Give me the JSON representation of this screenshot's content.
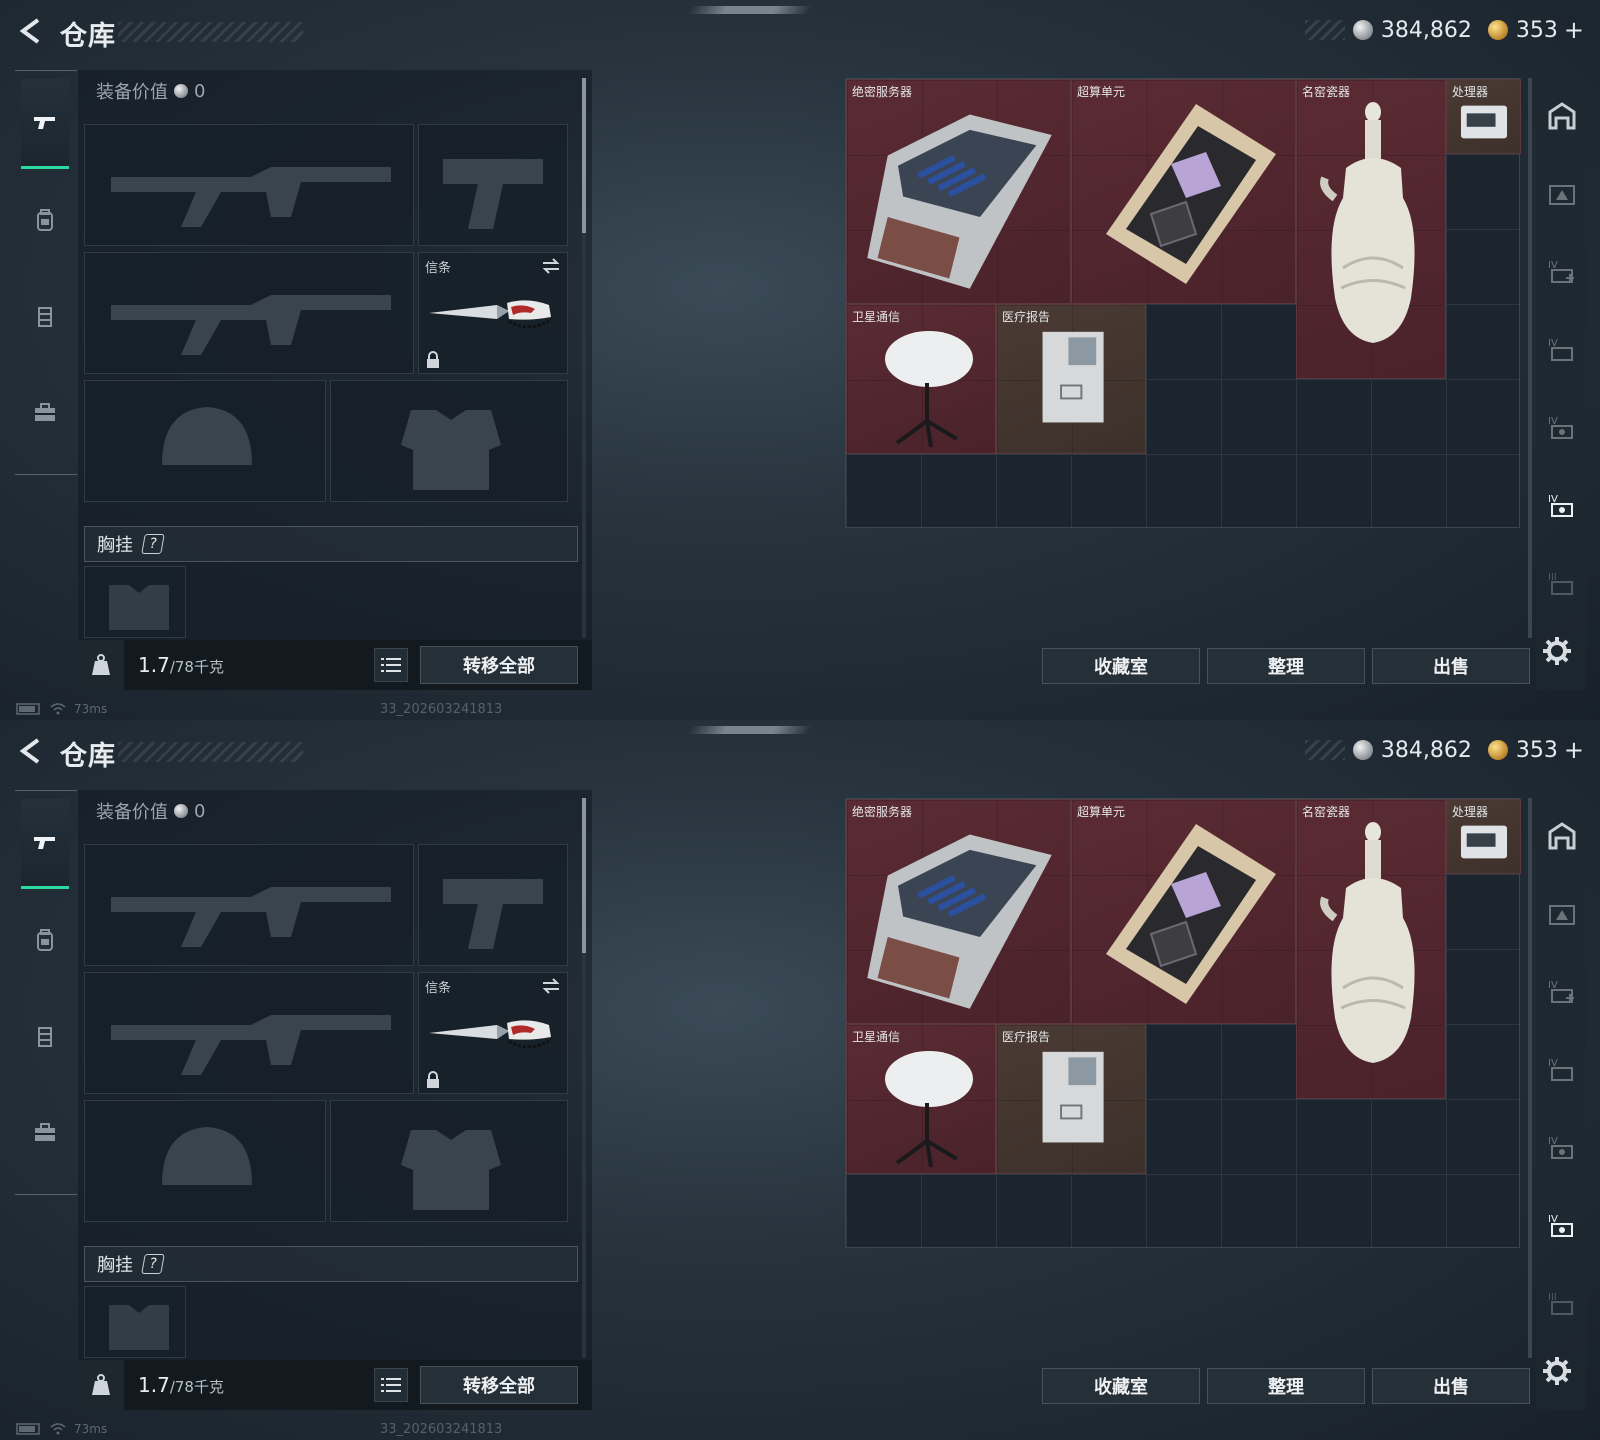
{
  "header": {
    "title": "仓库",
    "silver_amount": "384,862",
    "gold_amount": "353",
    "gold_plus": "+"
  },
  "left_rail": {
    "tabs": [
      "pistol-icon",
      "backpack-icon",
      "armor-vest-icon",
      "toolbox-icon"
    ],
    "active_index": 0
  },
  "equipment": {
    "value_label": "装备价值",
    "value": "0",
    "melee_slot_label": "信条",
    "chest_rig_label": "胸挂",
    "chest_rig_help": "?",
    "weight_current": "1.7",
    "weight_max": "/78千克",
    "transfer_all_label": "转移全部"
  },
  "stash": {
    "items": [
      {
        "name": "绝密服务器",
        "color": "red"
      },
      {
        "name": "超算单元",
        "color": "red"
      },
      {
        "name": "名窑瓷器",
        "color": "red"
      },
      {
        "name": "处理器",
        "color": "brown"
      },
      {
        "name": "卫星通信",
        "color": "red"
      },
      {
        "name": "医疗报告",
        "color": "brown"
      }
    ],
    "buttons": {
      "collection": "收藏室",
      "sort": "整理",
      "sell": "出售"
    }
  },
  "status": {
    "ping": "73ms",
    "build": "33_202603241813"
  },
  "colors": {
    "accent": "#2bd89e",
    "item_red": "#5b2b33",
    "item_brown": "#4a3a33"
  }
}
